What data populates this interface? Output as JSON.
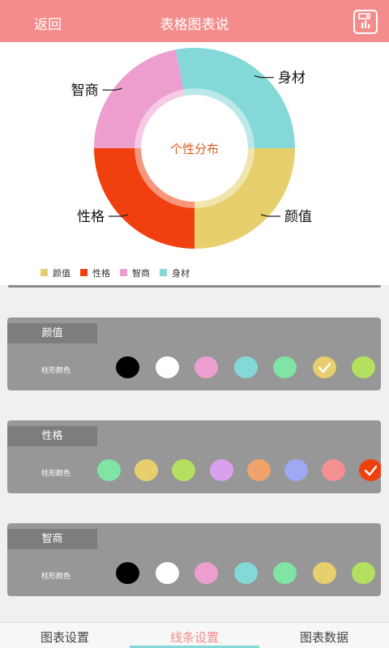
{
  "header": {
    "back_label": "返回",
    "title": "表格图表说"
  },
  "chart_data": {
    "type": "pie",
    "center_label": "个性分布",
    "categories": [
      "颜值",
      "性格",
      "智商",
      "身材"
    ],
    "values": [
      25,
      25,
      22,
      28
    ],
    "colors": [
      "#e6cf6c",
      "#f04010",
      "#ee9ece",
      "#84d8d8"
    ],
    "legend_position": "bottom-left"
  },
  "panels": [
    {
      "title": "颜值",
      "row_label": "柱形颜色",
      "swatches": [
        {
          "color": "#000000",
          "selected": false
        },
        {
          "color": "#ffffff",
          "selected": false
        },
        {
          "color": "#ee9ece",
          "selected": false
        },
        {
          "color": "#84d8d8",
          "selected": false
        },
        {
          "color": "#7fe4a4",
          "selected": false
        },
        {
          "color": "#e6cf6c",
          "selected": true
        },
        {
          "color": "#b4e060",
          "selected": false
        }
      ]
    },
    {
      "title": "性格",
      "row_label": "柱形颜色",
      "swatches": [
        {
          "color": "#7fe4a4",
          "selected": false
        },
        {
          "color": "#e6cf6c",
          "selected": false
        },
        {
          "color": "#b4e060",
          "selected": false
        },
        {
          "color": "#d9a0f0",
          "selected": false
        },
        {
          "color": "#f0a46c",
          "selected": false
        },
        {
          "color": "#9fa8f2",
          "selected": false
        },
        {
          "color": "#f49090",
          "selected": false
        },
        {
          "color": "#f04010",
          "selected": true
        }
      ]
    },
    {
      "title": "智商",
      "row_label": "柱形颜色",
      "swatches": [
        {
          "color": "#000000",
          "selected": false
        },
        {
          "color": "#ffffff",
          "selected": false
        },
        {
          "color": "#ee9ece",
          "selected": false
        },
        {
          "color": "#84d8d8",
          "selected": false
        },
        {
          "color": "#7fe4a4",
          "selected": false
        },
        {
          "color": "#e6cf6c",
          "selected": false
        },
        {
          "color": "#b4e060",
          "selected": false
        }
      ]
    }
  ],
  "tabs": [
    {
      "label": "图表设置",
      "active": false
    },
    {
      "label": "线条设置",
      "active": true
    },
    {
      "label": "图表数据",
      "active": false
    }
  ],
  "icons": {
    "save": "save-chart-icon",
    "check": "check-icon"
  }
}
